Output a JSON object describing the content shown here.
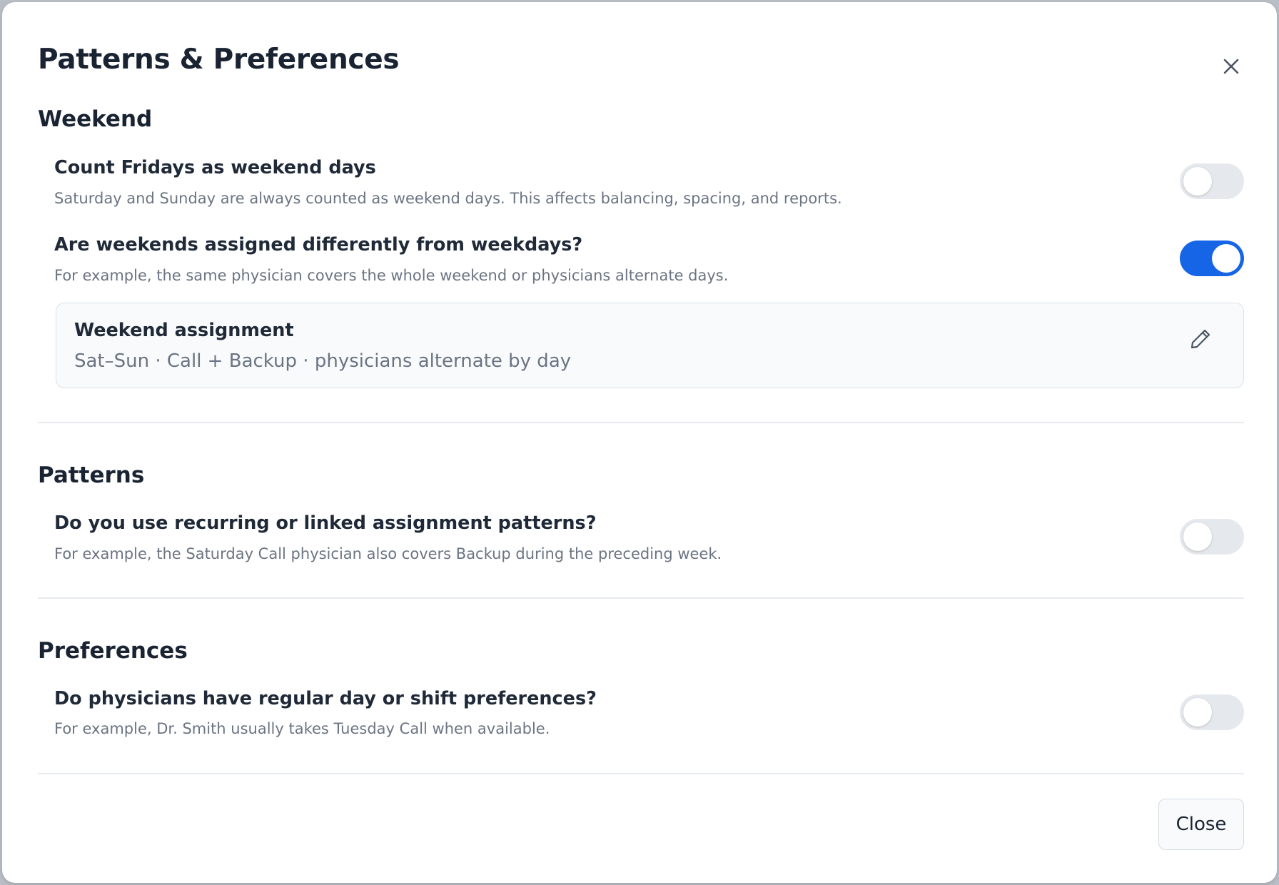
{
  "dialog": {
    "title": "Patterns & Preferences",
    "close_icon": "close-icon",
    "footer": {
      "close_label": "Close"
    }
  },
  "weekend": {
    "heading": "Weekend",
    "fridays": {
      "title": "Count Fridays as weekend days",
      "description": "Saturday and Sunday are always counted as weekend days. This affects balancing, spacing, and reports.",
      "enabled": false
    },
    "different": {
      "title": "Are weekends assigned differently from weekdays?",
      "description": "For example, the same physician covers the whole weekend or physicians alternate days.",
      "enabled": true
    },
    "assignment_card": {
      "title": "Weekend assignment",
      "summary": "Sat–Sun · Call + Backup · physicians alternate by day",
      "edit_icon": "pencil-icon"
    }
  },
  "patterns": {
    "heading": "Patterns",
    "recurring": {
      "title": "Do you use recurring or linked assignment patterns?",
      "description": "For example, the Saturday Call physician also covers Backup during the preceding week.",
      "enabled": false
    }
  },
  "preferences": {
    "heading": "Preferences",
    "regular": {
      "title": "Do physicians have regular day or shift preferences?",
      "description": "For example, Dr. Smith usually takes Tuesday Call when available.",
      "enabled": false
    }
  },
  "colors": {
    "accent": "#1565e6",
    "toggle_off": "#e5e8ec",
    "text_primary": "#1a2332",
    "text_secondary": "#6b7482"
  }
}
